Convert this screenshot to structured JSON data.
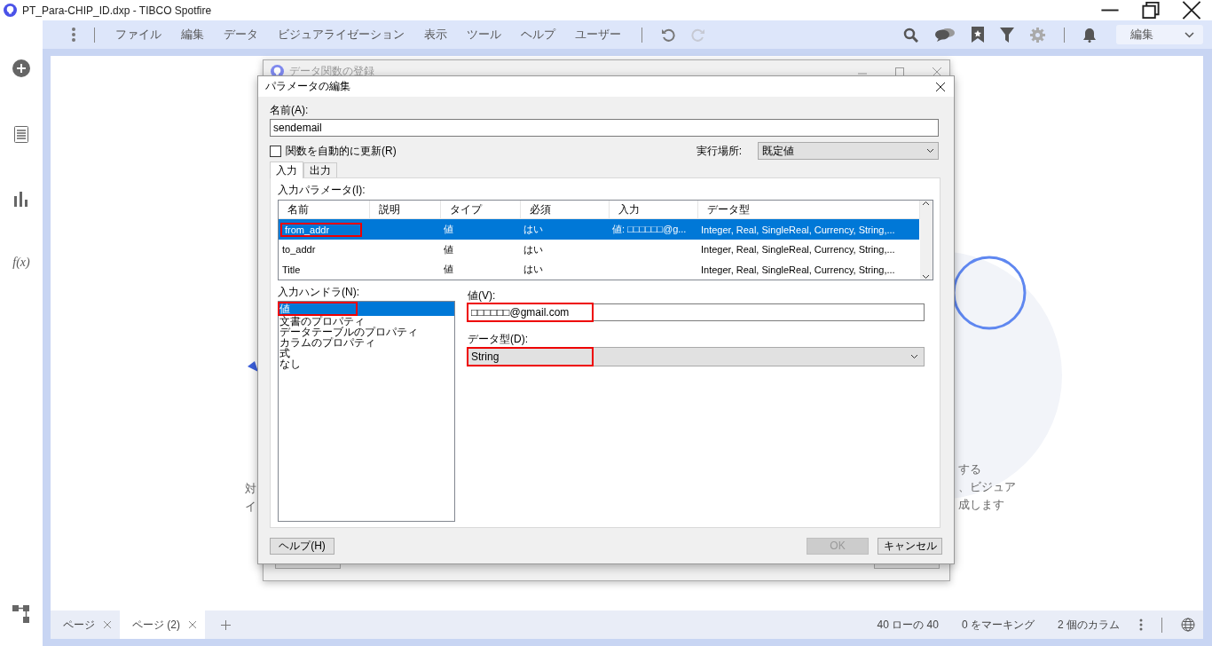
{
  "window": {
    "title": "PT_Para-CHIP_ID.dxp - TIBCO Spotfire"
  },
  "menu": {
    "items": [
      "ファイル",
      "編集",
      "データ",
      "ビジュアライゼーション",
      "表示",
      "ツール",
      "ヘルプ",
      "ユーザー"
    ],
    "mode": "編集"
  },
  "sidebar": {
    "function_label": "f(x)"
  },
  "canvas": {
    "left_texts": [
      "対",
      "イ"
    ],
    "right_texts": [
      "する",
      "、ビジュア",
      "成します"
    ]
  },
  "background_dialog": {
    "title": "データ関数の登録"
  },
  "dialog": {
    "title": "パラメータの編集",
    "name_label": "名前(A):",
    "name_value": "sendemail",
    "auto_update": {
      "label": "関数を自動的に更新(R)",
      "checked": false
    },
    "location": {
      "label": "実行場所:",
      "value": "既定値"
    },
    "tabs": [
      {
        "label": "入力",
        "selected": true
      },
      {
        "label": "出力",
        "selected": false
      }
    ],
    "parameters": {
      "label": "入力パラメータ(I):",
      "columns": [
        "名前",
        "説明",
        "タイプ",
        "必須",
        "入力",
        "データ型"
      ],
      "rows": [
        {
          "name": "from_addr",
          "type": "値",
          "required": "はい",
          "input": "値: □□□□□□@g...",
          "data_type": "Integer, Real, SingleReal, Currency, String,...",
          "selected": true,
          "highlighted": true
        },
        {
          "name": "to_addr",
          "type": "値",
          "required": "はい",
          "input": "",
          "data_type": "Integer, Real, SingleReal, Currency, String,...",
          "selected": false,
          "highlighted": false
        },
        {
          "name": "Title",
          "type": "値",
          "required": "はい",
          "input": "",
          "data_type": "Integer, Real, SingleReal, Currency, String,...",
          "selected": false,
          "highlighted": false
        }
      ]
    },
    "handlers": {
      "label": "入力ハンドラ(N):",
      "items": [
        {
          "label": "値",
          "selected": true,
          "highlighted": true
        },
        {
          "label": "文書のプロパティ",
          "selected": false,
          "highlighted": false
        },
        {
          "label": "データテーブルのプロパティ",
          "selected": false,
          "highlighted": false
        },
        {
          "label": "カラムのプロパティ",
          "selected": false,
          "highlighted": false
        },
        {
          "label": "式",
          "selected": false,
          "highlighted": false
        },
        {
          "label": "なし",
          "selected": false,
          "highlighted": false
        }
      ]
    },
    "value": {
      "label": "値(V):",
      "value": "□□□□□□@gmail.com",
      "highlighted": true
    },
    "data_type": {
      "label": "データ型(D):",
      "value": "String",
      "highlighted": true
    },
    "buttons": [
      {
        "kind": "help",
        "label": "ヘルプ(H)",
        "disabled": false
      },
      {
        "kind": "ok",
        "label": "OK",
        "disabled": true
      },
      {
        "kind": "cancel",
        "label": "キャンセル",
        "disabled": false
      }
    ]
  },
  "status_bar": {
    "pages": [
      {
        "label": "ページ",
        "selected": false
      },
      {
        "label": "ページ (2)",
        "selected": true
      }
    ],
    "texts": [
      "40 ローの 40",
      "0 をマーキング",
      "2 個のカラム"
    ]
  }
}
